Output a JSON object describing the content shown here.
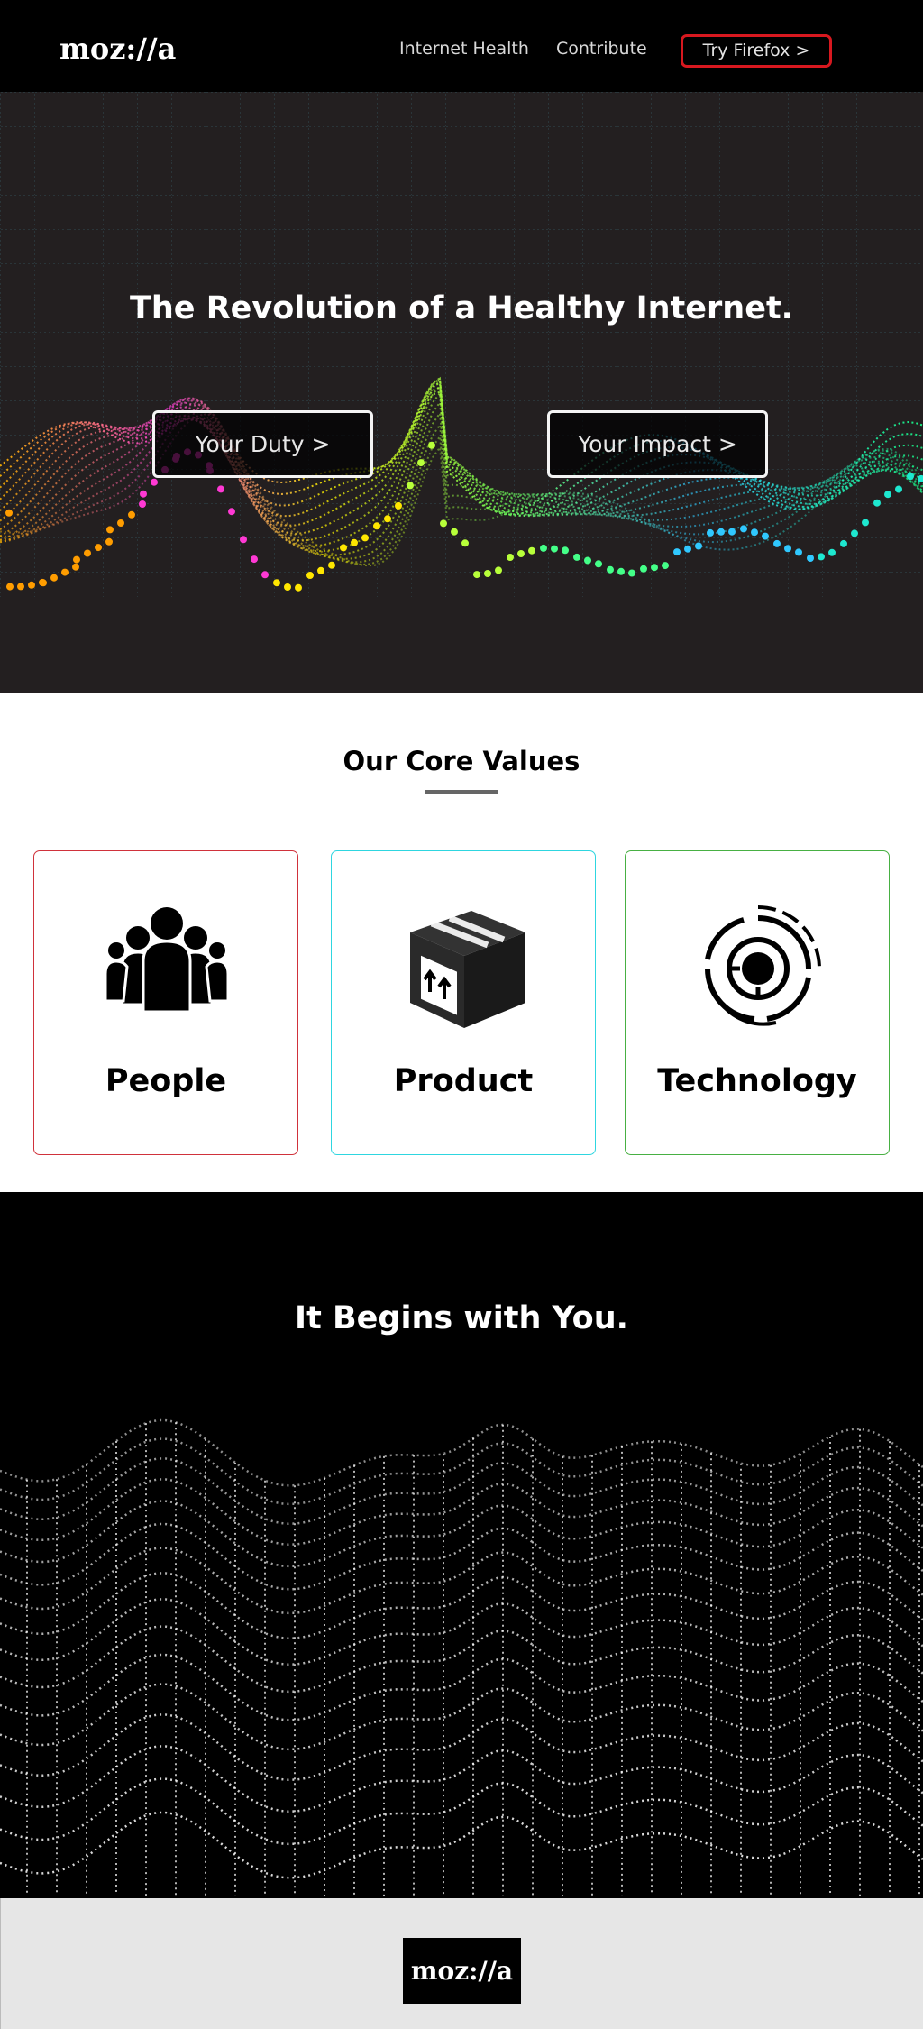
{
  "nav": {
    "logo": "moz://a",
    "links": [
      "Internet Health",
      "Contribute"
    ],
    "cta": "Try Firefox >"
  },
  "hero": {
    "title": "The Revolution of a Healthy Internet.",
    "buttons": [
      "Your Duty >",
      "Your Impact >"
    ]
  },
  "values": {
    "title": "Our Core Values",
    "cards": [
      {
        "label": "People",
        "icon": "people-icon",
        "border_color": "#d0323b"
      },
      {
        "label": "Product",
        "icon": "box-icon",
        "border_color": "#2ed6e0"
      },
      {
        "label": "Technology",
        "icon": "target-icon",
        "border_color": "#48b043"
      }
    ]
  },
  "begins": {
    "title": "It Begins with You."
  },
  "footer": {
    "logo": "moz://a"
  },
  "colors": {
    "cta_border": "#d7181f",
    "hero_bg": "#231f20"
  }
}
